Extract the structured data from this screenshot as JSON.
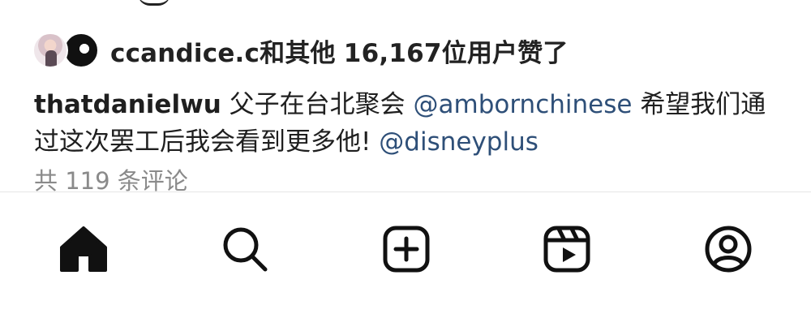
{
  "post": {
    "likes": {
      "user": "ccandice.c",
      "connector": "和其他",
      "count": "16,167",
      "suffix": "位用户赞了"
    },
    "caption": {
      "username": "thatdanielwu",
      "text_1": "父子在台北聚会",
      "mention_1": "@ambornchinese",
      "text_2": "希望我们通过这次罢工后我会看到更多他!",
      "mention_2": "@disneyplus"
    },
    "comments_link": "共 119 条评论"
  },
  "bottom_nav": {
    "items": [
      {
        "name": "home",
        "icon": "home-icon",
        "active": true
      },
      {
        "name": "search",
        "icon": "search-icon",
        "active": false
      },
      {
        "name": "create",
        "icon": "plus-square-icon",
        "active": false
      },
      {
        "name": "reels",
        "icon": "reels-icon",
        "active": false
      },
      {
        "name": "profile",
        "icon": "profile-icon",
        "active": false
      }
    ]
  },
  "colors": {
    "text": "#1f1f1f",
    "mention": "#2e4f78",
    "muted": "#8a8a8a",
    "background": "#ffffff"
  }
}
